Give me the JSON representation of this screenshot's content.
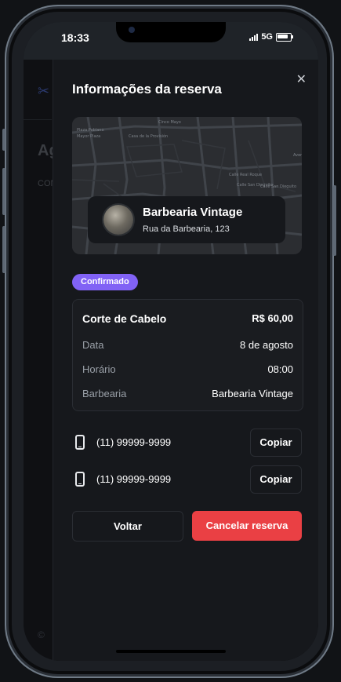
{
  "status_bar": {
    "time": "18:33",
    "network": "5G"
  },
  "background_page": {
    "title": "Ag",
    "subtitle": "CON"
  },
  "sheet": {
    "title": "Informações da reserva",
    "close_icon": "close-icon"
  },
  "map": {
    "labels": [
      "Cinco Mayo",
      "Casa de la Provisión",
      "Plaza Poblano",
      "Mayor Plaza",
      "Calle Real Roque",
      "Calle San Dieguito",
      "Calle San Dieguito",
      "Avenida Central"
    ]
  },
  "barbershop": {
    "name": "Barbearia Vintage",
    "address": "Rua da Barbearia, 123"
  },
  "status_badge": {
    "label": "Confirmado",
    "color": "#8162f5"
  },
  "booking": {
    "service": "Corte de Cabelo",
    "price": "R$ 60,00",
    "rows": [
      {
        "label": "Data",
        "value": "8 de agosto"
      },
      {
        "label": "Horário",
        "value": "08:00"
      },
      {
        "label": "Barbearia",
        "value": "Barbearia Vintage"
      }
    ]
  },
  "phones": [
    {
      "number": "(11) 99999-9999",
      "copy_label": "Copiar"
    },
    {
      "number": "(11) 99999-9999",
      "copy_label": "Copiar"
    }
  ],
  "actions": {
    "back_label": "Voltar",
    "cancel_label": "Cancelar reserva",
    "cancel_color": "#ea4044"
  }
}
